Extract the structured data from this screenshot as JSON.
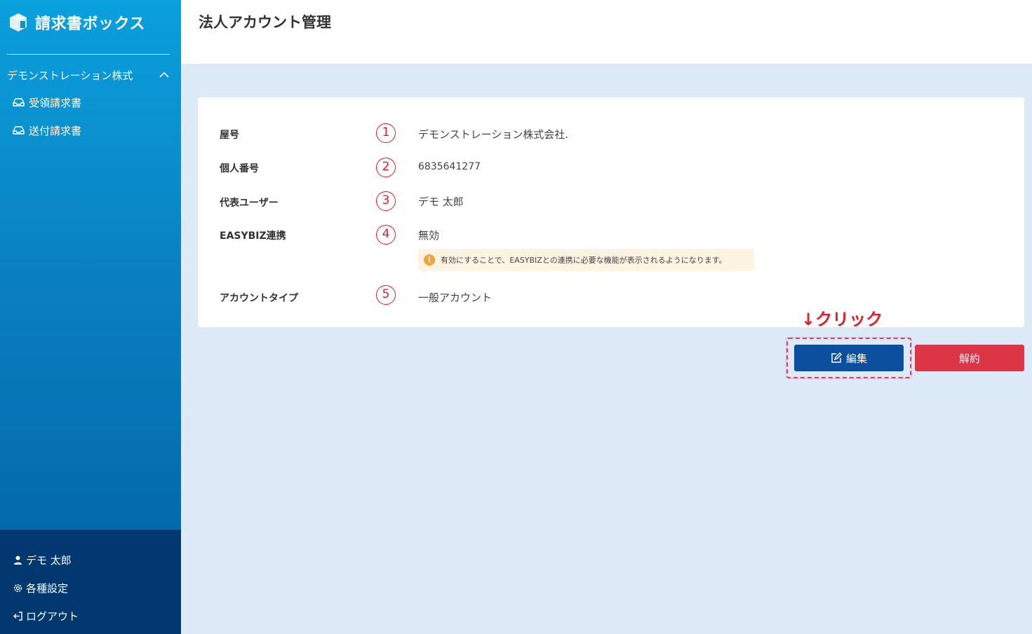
{
  "app": {
    "name": "請求書ボックス"
  },
  "sidebar": {
    "company": "デモンストレーション株式",
    "nav": [
      {
        "label": "受領請求書"
      },
      {
        "label": "送付請求書"
      }
    ],
    "bottom": [
      {
        "label": "デモ 太郎"
      },
      {
        "label": "各種設定"
      },
      {
        "label": "ログアウト"
      }
    ]
  },
  "header": {
    "title": "法人アカウント管理"
  },
  "details": {
    "rows": [
      {
        "label": "屋号",
        "num": "1",
        "value": "デモンストレーション株式会社."
      },
      {
        "label": "個人番号",
        "num": "2",
        "value": "6835641277"
      },
      {
        "label": "代表ユーザー",
        "num": "3",
        "value": "デモ 太郎"
      },
      {
        "label": "EASYBIZ連携",
        "num": "4",
        "value": "無効"
      },
      {
        "label": "アカウントタイプ",
        "num": "5",
        "value": "一般アカウント"
      }
    ],
    "info_icon": "i",
    "info_note": "有効にすることで、EASYBIZとの連携に必要な機能が表示されるようになります。"
  },
  "annotation": {
    "text": "↓クリック"
  },
  "actions": {
    "edit_label": "編集",
    "cancel_label": "解約"
  },
  "colors": {
    "primary": "#0c4f9e",
    "danger": "#dc3545",
    "annotation": "#e21c2a",
    "info_bg": "#fdf3e3",
    "info_icon": "#f3a33b"
  }
}
